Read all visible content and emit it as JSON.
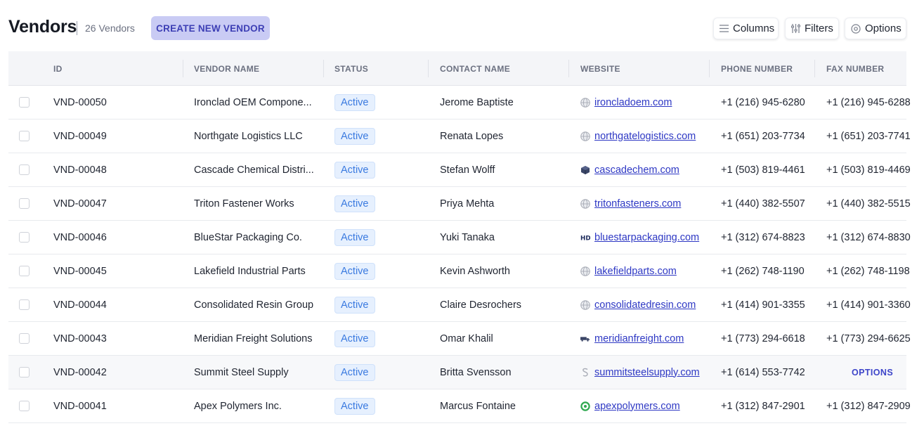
{
  "header": {
    "title": "Vendors",
    "count": "26 Vendors",
    "create_label": "CREATE NEW VENDOR",
    "columns_label": "Columns",
    "filters_label": "Filters",
    "options_label": "Options"
  },
  "table": {
    "columns": [
      "ID",
      "VENDOR NAME",
      "STATUS",
      "CONTACT NAME",
      "WEBSITE",
      "PHONE NUMBER",
      "FAX NUMBER"
    ],
    "rows": [
      {
        "id": "VND-00050",
        "name": "Ironclad OEM Compone...",
        "status": "Active",
        "contact": "Jerome Baptiste",
        "website": "ironcladoem.com",
        "favicon": "globe-icon",
        "phone": "+1 (216) 945-6280",
        "fax": "+1 (216) 945-6288"
      },
      {
        "id": "VND-00049",
        "name": "Northgate Logistics LLC",
        "status": "Active",
        "contact": "Renata Lopes",
        "website": "northgatelogistics.com",
        "favicon": "globe-icon",
        "phone": "+1 (651) 203-7734",
        "fax": "+1 (651) 203-7741"
      },
      {
        "id": "VND-00048",
        "name": "Cascade Chemical Distri...",
        "status": "Active",
        "contact": "Stefan Wolff",
        "website": "cascadechem.com",
        "favicon": "cube-icon",
        "phone": "+1 (503) 819-4461",
        "fax": "+1 (503) 819-4469"
      },
      {
        "id": "VND-00047",
        "name": "Triton Fastener Works",
        "status": "Active",
        "contact": "Priya Mehta",
        "website": "tritonfasteners.com",
        "favicon": "globe-icon",
        "phone": "+1 (440) 382-5507",
        "fax": "+1 (440) 382-5515"
      },
      {
        "id": "VND-00046",
        "name": "BlueStar Packaging Co.",
        "status": "Active",
        "contact": "Yuki Tanaka",
        "website": "bluestarpackaging.com",
        "favicon": "hd-logo-icon",
        "phone": "+1 (312) 674-8823",
        "fax": "+1 (312) 674-8830"
      },
      {
        "id": "VND-00045",
        "name": "Lakefield Industrial Parts",
        "status": "Active",
        "contact": "Kevin Ashworth",
        "website": "lakefieldparts.com",
        "favicon": "globe-icon",
        "phone": "+1 (262) 748-1190",
        "fax": "+1 (262) 748-1198"
      },
      {
        "id": "VND-00044",
        "name": "Consolidated Resin Group",
        "status": "Active",
        "contact": "Claire Desrochers",
        "website": "consolidatedresin.com",
        "favicon": "globe-icon",
        "phone": "+1 (414) 901-3355",
        "fax": "+1 (414) 901-3360"
      },
      {
        "id": "VND-00043",
        "name": "Meridian Freight Solutions",
        "status": "Active",
        "contact": "Omar Khalil",
        "website": "meridianfreight.com",
        "favicon": "truck-logo-icon",
        "phone": "+1 (773) 294-6618",
        "fax": "+1 (773) 294-6625"
      },
      {
        "id": "VND-00042",
        "name": "Summit Steel Supply",
        "status": "Active",
        "contact": "Britta Svensson",
        "website": "summitsteelsupply.com",
        "favicon": "s-logo-icon",
        "phone": "+1 (614) 553-7742",
        "fax": "OPTIONS"
      },
      {
        "id": "VND-00041",
        "name": "Apex Polymers Inc.",
        "status": "Active",
        "contact": "Marcus Fontaine",
        "website": "apexpolymers.com",
        "favicon": "green-ring-icon",
        "phone": "+1 (312) 847-2901",
        "fax": "+1 (312) 847-2909"
      }
    ]
  },
  "colors": {
    "accent": "#3d3fb5",
    "create_bg": "#c9cbf4",
    "badge_text": "#3a7ae0",
    "link": "#2e38c4"
  }
}
